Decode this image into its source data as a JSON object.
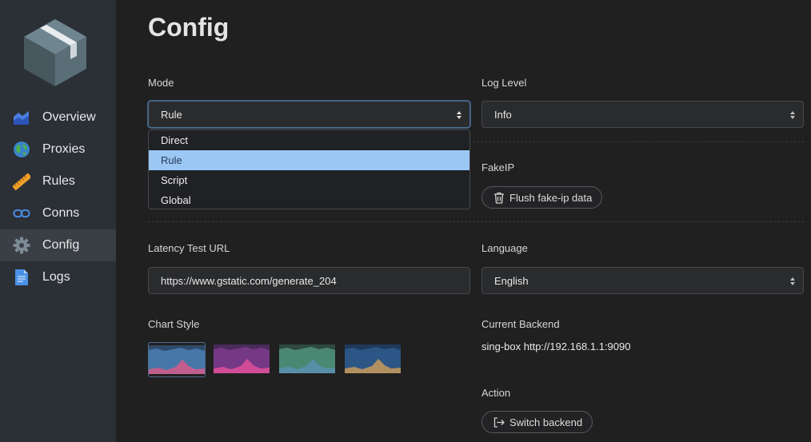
{
  "sidebar": {
    "items": [
      {
        "label": "Overview",
        "icon": "chart-area-icon"
      },
      {
        "label": "Proxies",
        "icon": "globe-icon"
      },
      {
        "label": "Rules",
        "icon": "ruler-icon"
      },
      {
        "label": "Conns",
        "icon": "link-icon"
      },
      {
        "label": "Config",
        "icon": "gear-icon",
        "active": true
      },
      {
        "label": "Logs",
        "icon": "document-icon"
      }
    ]
  },
  "page": {
    "title": "Config"
  },
  "mode": {
    "label": "Mode",
    "value": "Rule",
    "options": [
      "Direct",
      "Rule",
      "Script",
      "Global"
    ],
    "selected": "Rule"
  },
  "log_level": {
    "label": "Log Level",
    "value": "Info"
  },
  "fakeip": {
    "label": "FakeIP",
    "button": "Flush fake-ip data"
  },
  "latency": {
    "label": "Latency Test URL",
    "value": "https://www.gstatic.com/generate_204"
  },
  "language": {
    "label": "Language",
    "value": "English"
  },
  "chart_style": {
    "label": "Chart Style",
    "options": [
      {
        "name": "blue-pink",
        "back": "#4a7bb0",
        "front": "#d65a8a",
        "bg": "#2e4a6a"
      },
      {
        "name": "purple-pink",
        "back": "#7a3a8a",
        "front": "#e0509a",
        "bg": "#4a2a5a"
      },
      {
        "name": "green-blue",
        "back": "#4f8f7a",
        "front": "#5a8fb0",
        "bg": "#2e4a42"
      },
      {
        "name": "navy-orange",
        "back": "#2e5a8a",
        "front": "#c89a5a",
        "bg": "#1e3a5a"
      }
    ],
    "selected_index": 0
  },
  "backend": {
    "label": "Current Backend",
    "value": "sing-box http://192.168.1.1:9090"
  },
  "action": {
    "label": "Action",
    "button": "Switch backend"
  }
}
